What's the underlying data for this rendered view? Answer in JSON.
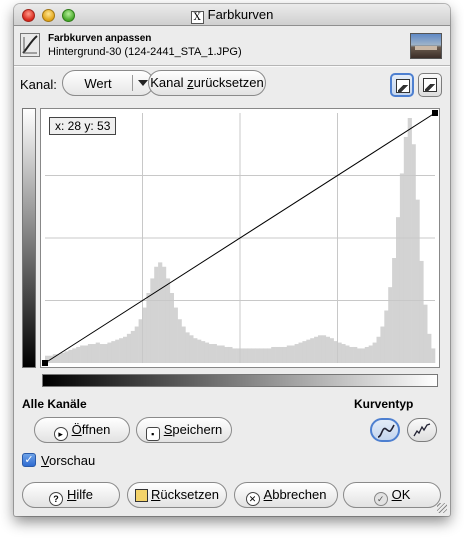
{
  "window": {
    "title": "Farbkurven",
    "title_icon": "x11-icon"
  },
  "header": {
    "title": "Farbkurven anpassen",
    "subtitle": "Hintergrund-30 (124-2441_STA_1.JPG)"
  },
  "channel": {
    "label": "Kanal:",
    "selected": "Wert",
    "reset_label_prefix": "Kanal ",
    "reset_label_mnemonic": "z",
    "reset_label_suffix": "urücksetzen",
    "mode_buttons": [
      "linear-histogram-icon",
      "log-histogram-icon"
    ]
  },
  "plot": {
    "coordinates": "x: 28 y: 53",
    "histogram_color": "#d3d3d3",
    "grid_color": "#c8c8c8",
    "curve_color": "#000000",
    "curve_points": [
      [
        0,
        0
      ],
      [
        255,
        255
      ]
    ],
    "grid_divisions": 4,
    "histogram_shape": [
      5,
      5,
      6,
      6,
      7,
      8,
      9,
      10,
      11,
      12,
      12,
      13,
      13,
      14,
      13,
      13,
      14,
      15,
      16,
      17,
      18,
      20,
      22,
      25,
      30,
      38,
      48,
      58,
      66,
      69,
      66,
      58,
      48,
      38,
      30,
      25,
      21,
      19,
      17,
      16,
      15,
      14,
      13,
      13,
      12,
      12,
      11,
      11,
      10,
      10,
      10,
      10,
      10,
      10,
      10,
      10,
      10,
      10,
      11,
      11,
      11,
      11,
      12,
      12,
      13,
      14,
      15,
      16,
      17,
      18,
      19,
      19,
      18,
      17,
      15,
      14,
      13,
      12,
      11,
      11,
      10,
      10,
      11,
      12,
      14,
      18,
      25,
      36,
      52,
      72,
      100,
      130,
      155,
      168,
      150,
      112,
      70,
      40,
      20,
      10
    ]
  },
  "sections": {
    "all_channels": "Alle Kanäle",
    "curve_type": "Kurventyp"
  },
  "buttons": {
    "open": {
      "mnemonic": "Ö",
      "rest": "ffnen"
    },
    "save": {
      "mnemonic": "S",
      "rest": "peichern"
    },
    "help": {
      "mnemonic": "H",
      "rest": "ilfe"
    },
    "reset": {
      "mnemonic": "R",
      "rest": "ücksetzen"
    },
    "cancel": {
      "mnemonic": "A",
      "rest": "bbrechen"
    },
    "ok": {
      "mnemonic": "O",
      "rest": "K"
    }
  },
  "preview": {
    "mnemonic": "V",
    "rest": "orschau",
    "checked": true
  },
  "curve_types": [
    "smooth-curve-icon",
    "freehand-curve-icon"
  ]
}
